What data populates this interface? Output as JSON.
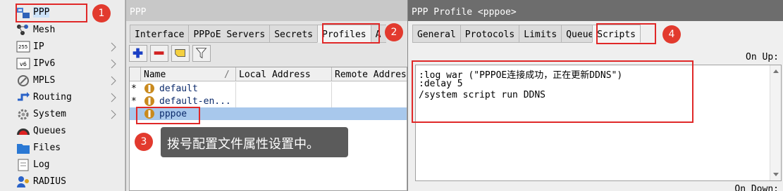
{
  "sidebar": {
    "items": [
      {
        "label": "PPP",
        "icon": "ppp-icon"
      },
      {
        "label": "Mesh",
        "icon": "mesh-icon"
      },
      {
        "label": "IP",
        "icon": "ip-icon"
      },
      {
        "label": "IPv6",
        "icon": "ipv6-icon"
      },
      {
        "label": "MPLS",
        "icon": "mpls-icon"
      },
      {
        "label": "Routing",
        "icon": "routing-icon"
      },
      {
        "label": "System",
        "icon": "system-gear-icon"
      },
      {
        "label": "Queues",
        "icon": "queues-icon"
      },
      {
        "label": "Files",
        "icon": "folder-icon"
      },
      {
        "label": "Log",
        "icon": "log-icon"
      },
      {
        "label": "RADIUS",
        "icon": "radius-icon"
      }
    ]
  },
  "ppp_window": {
    "title": "PPP",
    "tabs": [
      {
        "label": "Interface"
      },
      {
        "label": "PPPoE Servers"
      },
      {
        "label": "Secrets"
      },
      {
        "label": "Profiles"
      },
      {
        "label": "A"
      }
    ],
    "active_tab": "Profiles",
    "columns": [
      {
        "label": "Name"
      },
      {
        "label": "Local Address"
      },
      {
        "label": "Remote Address"
      }
    ],
    "sort_indicator": "/",
    "rows": [
      {
        "mark": "*",
        "name": "default"
      },
      {
        "mark": "*",
        "name": "default-en..."
      },
      {
        "mark": "",
        "name": "pppoe"
      }
    ]
  },
  "profile_window": {
    "title": "PPP Profile <pppoe>",
    "tabs": [
      {
        "label": "General"
      },
      {
        "label": "Protocols"
      },
      {
        "label": "Limits"
      },
      {
        "label": "Queue"
      },
      {
        "label": "Scripts"
      }
    ],
    "active_tab": "Scripts",
    "on_up_label": "On Up:",
    "on_down_label": "On Down:",
    "script_lines": [
      ":log war (\"PPPOE连接成功，正在更新DDNS\")",
      ":delay 5",
      "/system script run DDNS"
    ]
  },
  "annotations": {
    "badges": [
      "1",
      "2",
      "3",
      "4"
    ],
    "tooltip": "拨号配置文件属性设置中。"
  },
  "colors": {
    "annotation_red": "#e02828",
    "badge_red": "#e23a2e",
    "selected_row": "#a8c8ec",
    "tooltip_bg": "#5b5b5b",
    "add_blue": "#1a3fc4",
    "remove_red": "#d22020"
  }
}
